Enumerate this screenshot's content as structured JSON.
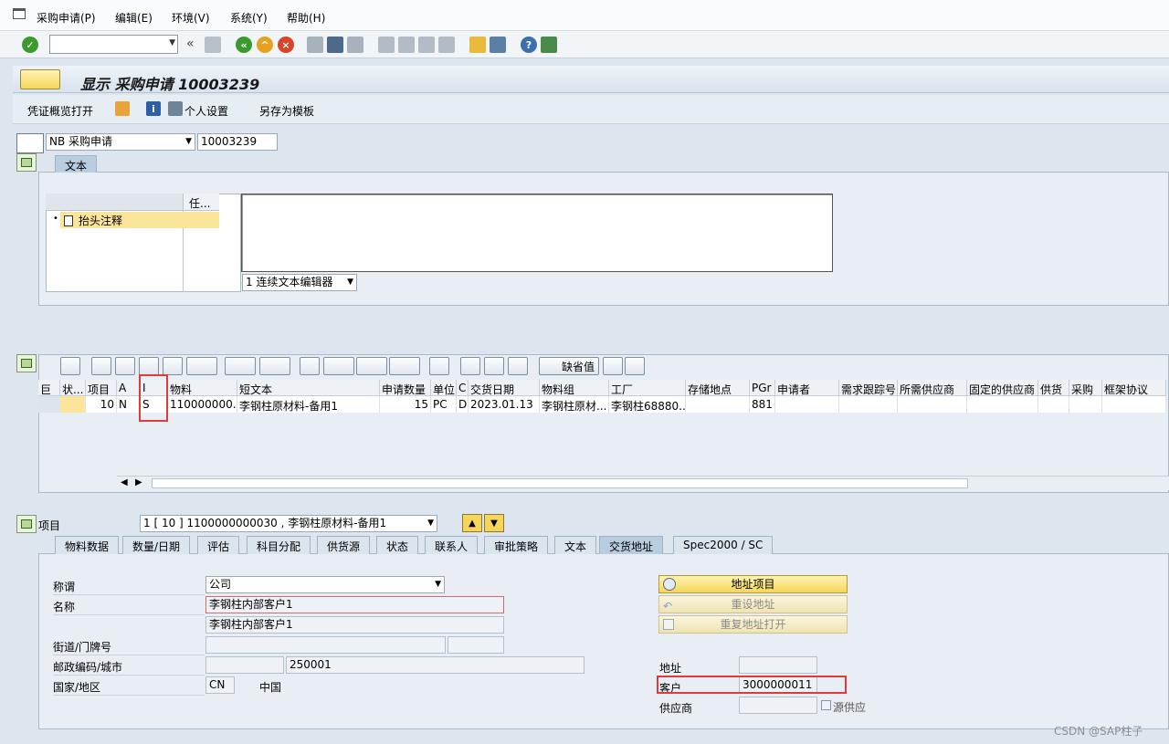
{
  "menu": {
    "items": [
      "采购申请(P)",
      "编辑(E)",
      "环境(V)",
      "系统(Y)",
      "帮助(H)"
    ]
  },
  "toolbar": {
    "collapse": "«"
  },
  "title": {
    "text": "显示 采购申请 10003239"
  },
  "app_toolbar": {
    "doc_overview": "凭证概览打开",
    "personal_settings": "个人设置",
    "save_as_template": "另存为模板"
  },
  "header": {
    "doc_type": "NB 采购申请",
    "doc_number": "10003239"
  },
  "text_section": {
    "tab": "文本",
    "col_header": "任...",
    "tree_item": "抬头注释",
    "editor_select": "1 连续文本编辑器"
  },
  "items_toolbar": {
    "default_values": "缺省值"
  },
  "grid": {
    "columns": [
      "巨",
      "状...",
      "项目",
      "A",
      "I",
      "物料",
      "短文本",
      "申请数量",
      "单位",
      "C",
      "交货日期",
      "物料组",
      "工厂",
      "存储地点",
      "PGr",
      "申请者",
      "需求跟踪号",
      "所需供应商",
      "固定的供应商",
      "供货",
      "采购",
      "框架协议"
    ],
    "rows": [
      [
        "",
        "",
        "10",
        "N",
        "S",
        "110000000...",
        "李钢柱原材料-备用1",
        "15",
        "PC",
        "D",
        "2023.01.13",
        "李钢柱原材...",
        "李钢柱68880...",
        "",
        "881",
        "",
        "",
        "",
        "",
        "",
        "",
        ""
      ]
    ]
  },
  "item_detail": {
    "label": "项目",
    "selector": "1 [ 10 ] 1100000000030 , 李钢柱原材料-备用1",
    "tabs": [
      "物料数据",
      "数量/日期",
      "评估",
      "科目分配",
      "供货源",
      "状态",
      "联系人",
      "审批策略",
      "文本",
      "交货地址",
      "Spec2000 / SC"
    ],
    "active_tab_index": 9
  },
  "address": {
    "title_label": "称谓",
    "title_value": "公司",
    "name_label": "名称",
    "name1": "李钢柱内部客户1",
    "name2": "李钢柱内部客户1",
    "street_label": "街道/门牌号",
    "postal_label": "邮政编码/城市",
    "city_value": "250001",
    "country_label": "国家/地区",
    "country_code": "CN",
    "country_name": "中国",
    "btn_address_item": "地址项目",
    "btn_reset_address": "重设地址",
    "btn_repeat_address": "重复地址打开",
    "addr_label": "地址",
    "customer_label": "客户",
    "customer_value": "3000000011",
    "vendor_label": "供应商",
    "source_supply_label": "源供应"
  },
  "watermark": "CSDN @SAP柱子",
  "colors": {
    "accent": "#f5d65a",
    "highlight": "#e13a3a",
    "selected": "#fbe59a"
  }
}
